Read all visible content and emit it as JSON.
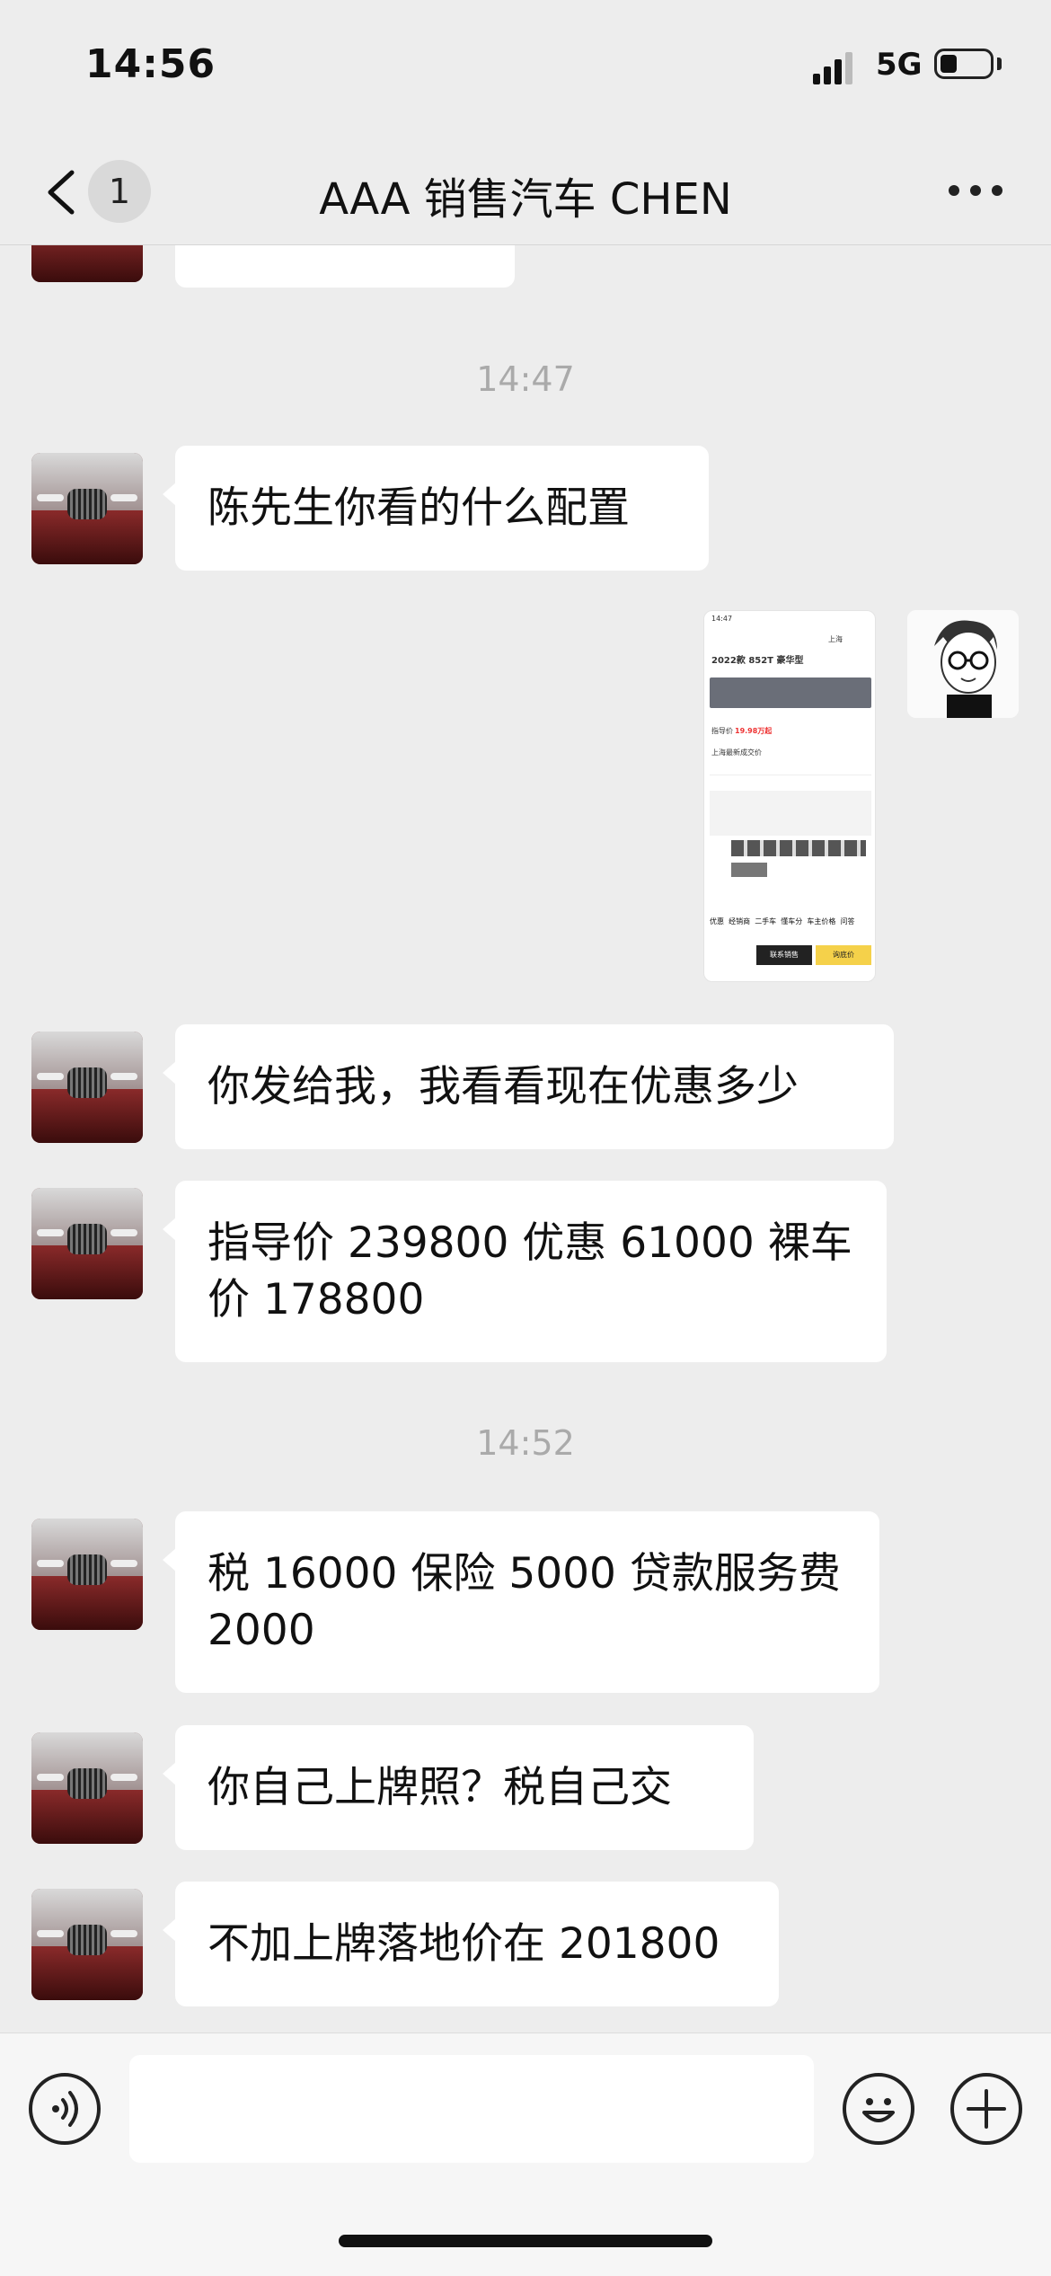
{
  "status": {
    "time": "14:56",
    "network": "5G",
    "battery_level": 0.35
  },
  "nav": {
    "back_badge": "1",
    "title": "AAA 销售汽车 CHEN"
  },
  "messages": [
    {
      "type": "text",
      "sender": "other",
      "text": ""
    },
    {
      "type": "timestamp",
      "text": "14:47"
    },
    {
      "type": "text",
      "sender": "other",
      "text": "陈先生你看的什么配置"
    },
    {
      "type": "image",
      "sender": "self",
      "image_text": {
        "status_time": "14:47",
        "location": "上海",
        "model": "2022款 852T 豪华型",
        "guide_price_label": "指导价",
        "guide_price": "19.98万起",
        "dealer_label": "上海最新成交价",
        "tabs": [
          "优惠",
          "经销商",
          "二手车",
          "懂车分",
          "车主价格",
          "问答"
        ],
        "cta": [
          "联系销售",
          "询底价"
        ]
      }
    },
    {
      "type": "text",
      "sender": "other",
      "text": "你发给我，我看看现在优惠多少"
    },
    {
      "type": "text",
      "sender": "other",
      "text": "指导价 239800 优惠 61000 裸车价 178800"
    },
    {
      "type": "timestamp",
      "text": "14:52"
    },
    {
      "type": "text",
      "sender": "other",
      "text": "税 16000 保险 5000 贷款服务费 2000"
    },
    {
      "type": "text",
      "sender": "other",
      "text": "你自己上牌照？税自己交"
    },
    {
      "type": "text",
      "sender": "other",
      "text": "不加上牌落地价在 201800"
    }
  ],
  "input": {
    "value": "",
    "placeholder": ""
  },
  "icons": {
    "back": "chevron-left-icon",
    "more": "more-dots-icon",
    "voice": "voice-icon",
    "emoji": "emoji-icon",
    "plus": "plus-icon"
  }
}
